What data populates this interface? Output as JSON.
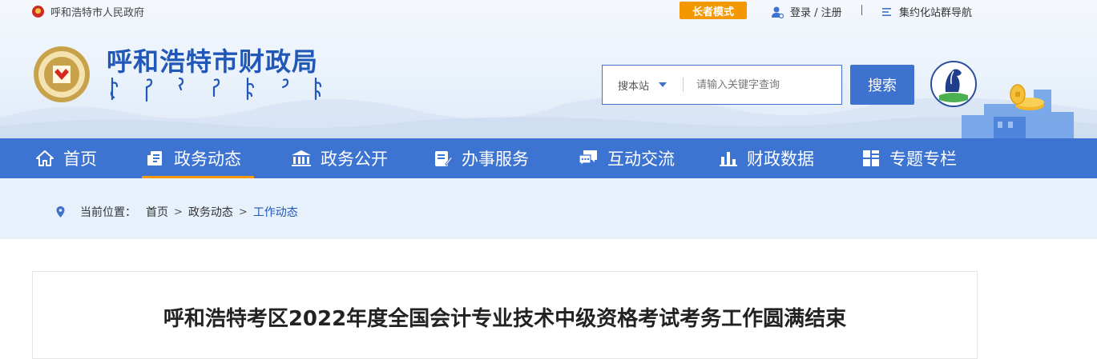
{
  "topbar": {
    "gov_link": "呼和浩特市人民政府",
    "elder_mode": "长者模式",
    "login": "登录 / 注册",
    "site_nav": "集约化站群导航"
  },
  "header": {
    "title": "呼和浩特市财政局",
    "search": {
      "scope": "搜本站",
      "placeholder": "请输入关键字查询",
      "button": "搜索"
    }
  },
  "nav": {
    "items": [
      {
        "label": "首页",
        "icon": "home-icon"
      },
      {
        "label": "政务动态",
        "icon": "news-icon",
        "active": true
      },
      {
        "label": "政务公开",
        "icon": "building-icon"
      },
      {
        "label": "办事服务",
        "icon": "service-icon"
      },
      {
        "label": "互动交流",
        "icon": "chat-icon"
      },
      {
        "label": "财政数据",
        "icon": "bar-chart-icon"
      },
      {
        "label": "专题专栏",
        "icon": "grid-icon"
      }
    ]
  },
  "breadcrumb": {
    "prefix": "当前位置：",
    "items": [
      "首页",
      "政务动态",
      "工作动态"
    ],
    "separator": ">"
  },
  "article": {
    "title": "呼和浩特考区2022年度全国会计专业技术中级资格考试考务工作圆满结束"
  },
  "colors": {
    "brand_blue": "#3d74d2",
    "accent_orange": "#f39800",
    "title_blue": "#2158b8"
  }
}
